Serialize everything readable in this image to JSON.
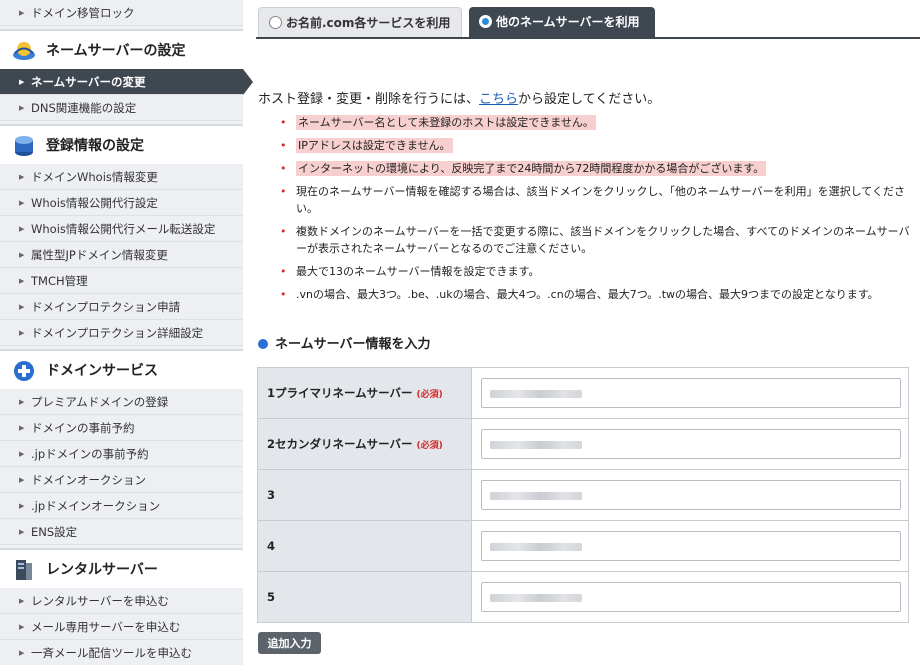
{
  "sidebar": {
    "top_item": "ドメイン移管ロック",
    "ns_section": {
      "title": "ネームサーバーの設定",
      "items": [
        "ネームサーバーの変更",
        "DNS関連機能の設定"
      ]
    },
    "reg_section": {
      "title": "登録情報の設定",
      "items": [
        "ドメインWhois情報変更",
        "Whois情報公開代行設定",
        "Whois情報公開代行メール転送設定",
        "属性型JPドメイン情報変更",
        "TMCH管理",
        "ドメインプロテクション申請",
        "ドメインプロテクション詳細設定"
      ]
    },
    "domain_section": {
      "title": "ドメインサービス",
      "items": [
        "プレミアムドメインの登録",
        "ドメインの事前予約",
        ".jpドメインの事前予約",
        "ドメインオークション",
        ".jpドメインオークション",
        "ENS設定"
      ]
    },
    "rental_section": {
      "title": "レンタルサーバー",
      "items": [
        "レンタルサーバーを申込む",
        "メール専用サーバーを申込む",
        "一斉メール配信ツールを申込む"
      ]
    }
  },
  "tabs": {
    "tab1": "お名前.com各サービスを利用",
    "tab2": "他のネームサーバーを利用"
  },
  "intro": {
    "before": "ホスト登録・変更・削除を行うには、",
    "link": "こちら",
    "after": "から設定してください。"
  },
  "notes": [
    "ネームサーバー名として未登録のホストは設定できません。",
    "IPアドレスは設定できません。",
    "インターネットの環境により、反映完了まで24時間から72時間程度かかる場合がございます。",
    "現在のネームサーバー情報を確認する場合は、該当ドメインをクリックし、「他のネームサーバーを利用」を選択してください。",
    "複数ドメインのネームサーバーを一括で変更する際に、該当ドメインをクリックした場合、すべてのドメインのネームサーバーが表示されたネームサーバーとなるのでご注意ください。",
    "最大で13のネームサーバー情報を設定できます。",
    ".vnの場合、最大3つ。.be、.ukの場合、最大4つ。.cnの場合、最大7つ。.twの場合、最大9つまでの設定となります。"
  ],
  "section_title": "ネームサーバー情報を入力",
  "required_label": "(必須)",
  "rows": [
    {
      "label": "1プライマリネームサーバー"
    },
    {
      "label": "2セカンダリネームサーバー"
    },
    {
      "label": "3"
    },
    {
      "label": "4"
    },
    {
      "label": "5"
    }
  ],
  "add_button": "追加入力",
  "colors": {
    "accent": "#3f4750",
    "link": "#1a5fb4",
    "required": "#d12a2a",
    "highlight": "#f7cfcf"
  }
}
